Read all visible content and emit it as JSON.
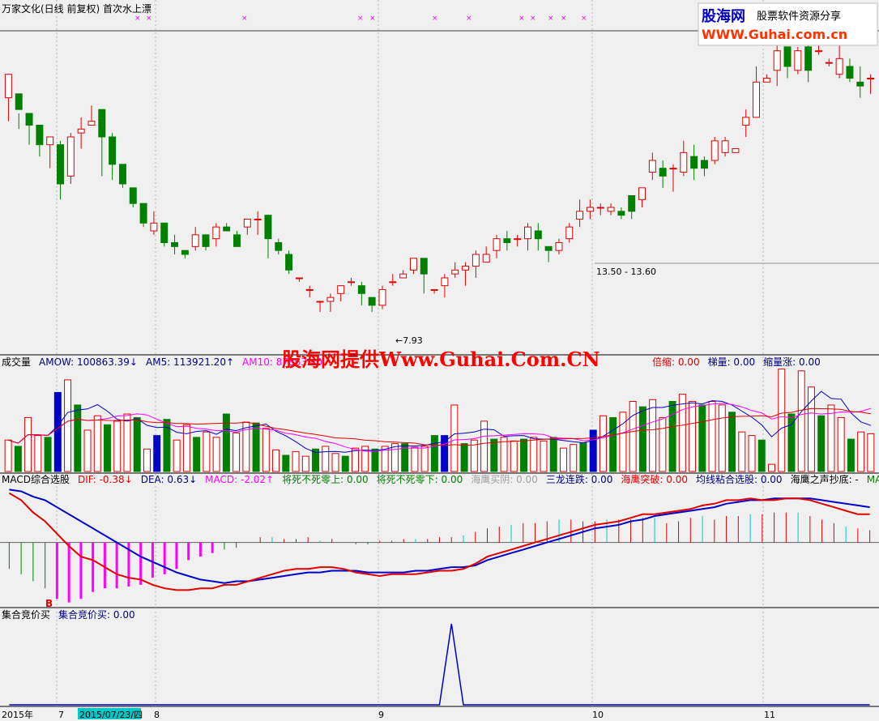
{
  "header": {
    "title": "万家文化(日线 前复权) 首次水上漂"
  },
  "logo": {
    "brand": "股海网",
    "tagline": "股票软件资源分享",
    "url": "WWW.Guhai.com.cn"
  },
  "watermark": "股海网提供Www.Guhai.Com.CN",
  "colors": {
    "bg": "#f0f0f0",
    "up": "#e00000",
    "down": "#008000",
    "blue": "#0000c8",
    "magenta": "#ff00ff",
    "cyan": "#00c8c8",
    "grid": "#b4b4b4",
    "text_blue": "#000080"
  },
  "panels": {
    "volume": {
      "labels": [
        {
          "text": "成交量",
          "color": "#000000"
        },
        {
          "text": "AMOW: 100863.39↓",
          "color": "#000080"
        },
        {
          "text": "AM5: 113921.20↑",
          "color": "#000080"
        },
        {
          "text": "AM10: 87863.40",
          "color": "#ff00ff"
        },
        {
          "text": "倍缩: 0.00",
          "color": "#e00000"
        },
        {
          "text": "梯量: 0.00",
          "color": "#000080"
        },
        {
          "text": "缩量涨: 0.00",
          "color": "#000080"
        }
      ]
    },
    "macd": {
      "labels": [
        {
          "text": "MACD综合选股",
          "color": "#000000"
        },
        {
          "text": "DIF: -0.38↓",
          "color": "#e00000"
        },
        {
          "text": "DEA: 0.63↓",
          "color": "#000080"
        },
        {
          "text": "MACD: -2.02↑",
          "color": "#ff00ff"
        },
        {
          "text": "将死不死零上: 0.00",
          "color": "#008000"
        },
        {
          "text": "将死不死零下: 0.00",
          "color": "#008000"
        },
        {
          "text": "海鹰买阴: 0.00",
          "color": "#a0a0a0"
        },
        {
          "text": "三龙连跌: 0.00",
          "color": "#000080"
        },
        {
          "text": "海鹰突破: 0.00",
          "color": "#e00000"
        },
        {
          "text": "均线粘合选股: 0.00",
          "color": "#000080"
        },
        {
          "text": "海鹰之声抄底: -",
          "color": "#000000"
        },
        {
          "text": "MACD抄底",
          "color": "#008000"
        }
      ],
      "b_marker": "B"
    },
    "auction": {
      "labels": [
        {
          "text": "集合竞价买",
          "color": "#000000"
        },
        {
          "text": "集合竞价买: 0.00",
          "color": "#000080"
        }
      ]
    }
  },
  "chart_data": {
    "type": "candlestick",
    "price_annotations": {
      "low_label": "7.93",
      "range_label": "13.50 - 13.60"
    },
    "x_axis": {
      "labels": [
        "2015年",
        "7",
        "2015/07/23/四",
        "8",
        "9",
        "10",
        "11"
      ],
      "highlight": "2015/07/23/四"
    },
    "candles": [
      [
        13.4,
        14.0,
        12.8,
        13.5
      ],
      [
        13.5,
        13.1,
        12.6,
        13.0
      ],
      [
        13.0,
        12.7,
        12.2,
        12.9
      ],
      [
        12.7,
        12.2,
        11.9,
        12.2
      ],
      [
        12.2,
        12.4,
        11.6,
        12.2
      ],
      [
        12.2,
        11.2,
        10.8,
        12.3
      ],
      [
        11.4,
        12.4,
        11.2,
        12.5
      ],
      [
        12.5,
        12.6,
        12.1,
        12.9
      ],
      [
        12.7,
        12.8,
        12.7,
        13.2
      ],
      [
        13.1,
        12.4,
        11.4,
        13.1
      ],
      [
        12.4,
        11.7,
        11.3,
        12.5
      ],
      [
        11.7,
        11.2,
        11.1,
        11.7
      ],
      [
        11.1,
        10.7,
        10.6,
        11.1
      ],
      [
        10.7,
        10.2,
        10.1,
        10.7
      ],
      [
        10.0,
        10.2,
        9.9,
        10.5
      ],
      [
        10.2,
        9.7,
        9.6,
        10.2
      ],
      [
        9.7,
        9.6,
        9.4,
        9.9
      ],
      [
        9.5,
        9.4,
        9.3,
        9.5
      ],
      [
        9.6,
        9.9,
        9.5,
        10.1
      ],
      [
        9.9,
        9.6,
        9.5,
        9.9
      ],
      [
        9.8,
        10.1,
        9.6,
        10.2
      ],
      [
        10.1,
        10.0,
        10.0,
        10.2
      ],
      [
        9.9,
        9.6,
        9.6,
        10.0
      ],
      [
        10.1,
        10.3,
        9.9,
        10.3
      ],
      [
        10.3,
        10.3,
        9.9,
        10.5
      ],
      [
        10.4,
        9.8,
        9.3,
        10.4
      ],
      [
        9.7,
        9.5,
        9.4,
        9.8
      ],
      [
        9.4,
        9.0,
        8.9,
        9.5
      ],
      [
        8.8,
        8.8,
        8.7,
        8.8
      ],
      [
        8.5,
        8.5,
        8.3,
        8.6
      ],
      [
        8.2,
        8.2,
        7.93,
        8.2
      ],
      [
        8.2,
        8.3,
        7.93,
        8.4
      ],
      [
        8.4,
        8.6,
        8.2,
        8.6
      ],
      [
        8.7,
        8.7,
        8.6,
        8.8
      ],
      [
        8.6,
        8.4,
        8.1,
        8.7
      ],
      [
        8.3,
        8.1,
        7.93,
        8.3
      ],
      [
        8.1,
        8.5,
        8.0,
        8.6
      ],
      [
        8.7,
        8.7,
        8.6,
        8.9
      ],
      [
        8.8,
        8.9,
        8.8,
        9.0
      ],
      [
        9.0,
        9.3,
        8.9,
        9.3
      ],
      [
        9.3,
        8.9,
        8.4,
        9.3
      ],
      [
        8.5,
        8.5,
        8.4,
        8.5
      ],
      [
        8.6,
        8.8,
        8.3,
        8.9
      ],
      [
        8.9,
        9.0,
        8.8,
        9.2
      ],
      [
        9.0,
        9.1,
        8.6,
        9.2
      ],
      [
        9.1,
        9.4,
        8.8,
        9.5
      ],
      [
        9.2,
        9.4,
        9.2,
        9.6
      ],
      [
        9.5,
        9.8,
        9.3,
        9.9
      ],
      [
        9.8,
        9.7,
        9.5,
        10.0
      ],
      [
        9.8,
        9.8,
        9.6,
        9.9
      ],
      [
        9.8,
        10.1,
        9.5,
        10.2
      ],
      [
        10.0,
        9.8,
        9.5,
        10.2
      ],
      [
        9.6,
        9.5,
        9.2,
        9.6
      ],
      [
        9.5,
        9.7,
        9.4,
        9.8
      ],
      [
        9.8,
        10.1,
        9.7,
        10.2
      ],
      [
        10.3,
        10.5,
        10.1,
        10.8
      ],
      [
        10.5,
        10.6,
        10.3,
        10.8
      ],
      [
        10.6,
        10.6,
        10.4,
        10.7
      ],
      [
        10.5,
        10.6,
        10.4,
        10.7
      ],
      [
        10.5,
        10.4,
        10.3,
        10.6
      ],
      [
        10.9,
        10.5,
        10.3,
        10.9
      ],
      [
        10.8,
        11.1,
        10.6,
        11.1
      ],
      [
        11.5,
        11.8,
        11.3,
        12.0
      ],
      [
        11.6,
        11.4,
        11.1,
        11.8
      ],
      [
        11.6,
        11.6,
        11.0,
        11.7
      ],
      [
        11.5,
        12.0,
        11.4,
        12.3
      ],
      [
        11.9,
        11.6,
        11.3,
        12.2
      ],
      [
        11.8,
        11.6,
        11.4,
        11.9
      ],
      [
        11.8,
        12.3,
        11.7,
        12.4
      ],
      [
        12.0,
        12.3,
        11.9,
        12.4
      ],
      [
        12.0,
        12.1,
        12.0,
        12.1
      ],
      [
        12.7,
        12.9,
        12.4,
        13.1
      ],
      [
        12.9,
        13.8,
        12.9,
        14.2
      ],
      [
        13.8,
        13.9,
        13.8,
        14.0
      ],
      [
        14.1,
        14.6,
        13.7,
        14.8
      ],
      [
        14.7,
        14.2,
        13.9,
        14.7
      ],
      [
        14.1,
        14.6,
        14.0,
        14.7
      ],
      [
        14.7,
        14.1,
        13.8,
        14.9
      ],
      [
        14.6,
        14.6,
        14.5,
        14.9
      ],
      [
        14.3,
        14.3,
        14.2,
        14.4
      ],
      [
        14.0,
        14.4,
        13.9,
        14.9
      ],
      [
        14.2,
        13.9,
        13.8,
        14.4
      ],
      [
        13.8,
        13.7,
        13.4,
        14.2
      ],
      [
        13.9,
        13.9,
        13.5,
        14.0
      ]
    ],
    "volume": {
      "ylim": [
        0,
        110
      ],
      "values": [
        35,
        28,
        60,
        40,
        38,
        88,
        102,
        74,
        46,
        62,
        52,
        56,
        64,
        60,
        25,
        40,
        58,
        35,
        52,
        38,
        44,
        38,
        64,
        43,
        55,
        54,
        48,
        24,
        18,
        22,
        17,
        25,
        28,
        20,
        17,
        26,
        28,
        25,
        28,
        31,
        31,
        27,
        28,
        40,
        40,
        74,
        31,
        35,
        56,
        36,
        38,
        34,
        36,
        38,
        34,
        38,
        26,
        30,
        32,
        46,
        62,
        60,
        66,
        78,
        72,
        80,
        60,
        78,
        86,
        78,
        74,
        78,
        74,
        66,
        44,
        40,
        35,
        8,
        114,
        64,
        112,
        94,
        62,
        74,
        60,
        36,
        44,
        42
      ],
      "blue_at": [
        5,
        15,
        44,
        59
      ]
    },
    "macd": {
      "ylim": [
        -3.6,
        3.2
      ],
      "dif": [
        2.8,
        2.4,
        1.7,
        1.2,
        0.5,
        -0.2,
        -0.8,
        -1.0,
        -1.4,
        -1.8,
        -2.0,
        -2.1,
        -2.4,
        -2.6,
        -2.7,
        -2.7,
        -2.6,
        -2.6,
        -2.4,
        -2.4,
        -2.2,
        -2.0,
        -1.8,
        -1.6,
        -1.5,
        -1.5,
        -1.4,
        -1.4,
        -1.5,
        -1.7,
        -1.8,
        -1.9,
        -1.8,
        -1.8,
        -1.8,
        -1.7,
        -1.6,
        -1.6,
        -1.5,
        -1.2,
        -0.8,
        -0.6,
        -0.4,
        -0.2,
        0.0,
        0.2,
        0.4,
        0.6,
        0.8,
        1.0,
        1.1,
        1.2,
        1.4,
        1.6,
        1.6,
        1.7,
        1.8,
        1.9,
        2.1,
        2.2,
        2.4,
        2.4,
        2.5,
        2.4,
        2.4,
        2.5,
        2.5,
        2.4,
        2.2,
        2.0,
        1.8,
        1.6,
        1.6
      ],
      "dea": [
        3.0,
        2.9,
        2.6,
        2.4,
        2.0,
        1.6,
        1.2,
        0.8,
        0.4,
        0.0,
        -0.4,
        -0.8,
        -1.1,
        -1.4,
        -1.7,
        -1.9,
        -2.1,
        -2.2,
        -2.3,
        -2.2,
        -2.2,
        -2.1,
        -2.0,
        -1.9,
        -1.8,
        -1.7,
        -1.7,
        -1.6,
        -1.6,
        -1.6,
        -1.7,
        -1.7,
        -1.7,
        -1.7,
        -1.6,
        -1.6,
        -1.5,
        -1.4,
        -1.4,
        -1.3,
        -1.0,
        -0.8,
        -0.6,
        -0.4,
        -0.2,
        0.0,
        0.2,
        0.4,
        0.6,
        0.8,
        0.9,
        1.0,
        1.2,
        1.3,
        1.5,
        1.6,
        1.7,
        1.8,
        1.9,
        2.0,
        2.2,
        2.3,
        2.4,
        2.4,
        2.5,
        2.5,
        2.5,
        2.5,
        2.4,
        2.3,
        2.2,
        2.1,
        2.0
      ],
      "hist": [
        -1.5,
        -1.8,
        -2.2,
        -2.6,
        -3.2,
        -3.4,
        -3.2,
        -2.8,
        -2.6,
        -2.6,
        -2.5,
        -2.4,
        -2.0,
        -1.8,
        -1.5,
        -1.0,
        -0.8,
        -0.6,
        -0.4,
        -0.3,
        0.0,
        0.3,
        0.3,
        0.2,
        0.2,
        0.3,
        0.1,
        0.2,
        0.0,
        -0.1,
        -0.1,
        0.1,
        0.1,
        0.2,
        0.2,
        0.2,
        0.3,
        0.3,
        0.4,
        0.6,
        0.8,
        0.9,
        1.0,
        1.1,
        1.1,
        1.2,
        1.3,
        1.3,
        1.2,
        1.2,
        1.3,
        1.3,
        1.3,
        1.4,
        1.4,
        1.1,
        1.2,
        1.4,
        1.5,
        1.3,
        1.5,
        1.5,
        1.6,
        1.6,
        1.7,
        1.7,
        1.7,
        1.5,
        1.3,
        1.1,
        0.9,
        0.8,
        0.7
      ]
    },
    "auction": {
      "ylim": [
        0,
        100
      ],
      "values": [
        0,
        0,
        0,
        0,
        0,
        0,
        0,
        0,
        0,
        0,
        0,
        0,
        0,
        0,
        0,
        0,
        0,
        0,
        0,
        0,
        0,
        0,
        0,
        0,
        0,
        0,
        0,
        0,
        0,
        0,
        0,
        0,
        0,
        0,
        0,
        0,
        0,
        100,
        0,
        0,
        0,
        0,
        0,
        0,
        0,
        0,
        0,
        0,
        0,
        0,
        0,
        0,
        0,
        0,
        0,
        0,
        0,
        0,
        0,
        0,
        0,
        0,
        0,
        0,
        0,
        0,
        0,
        0,
        0,
        0,
        0,
        0,
        0
      ]
    }
  }
}
